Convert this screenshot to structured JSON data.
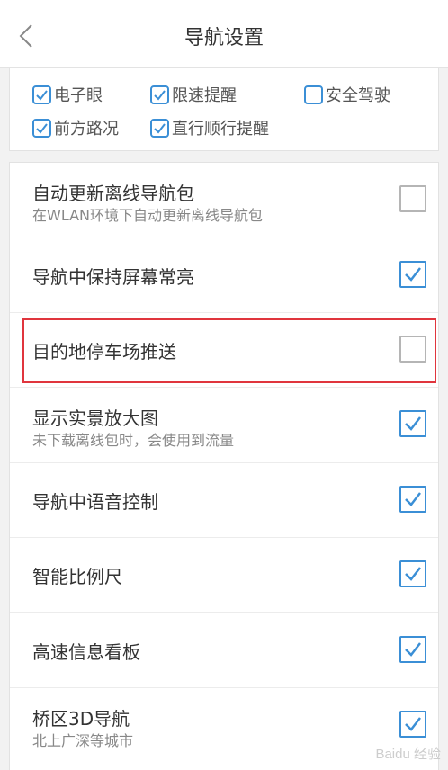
{
  "header": {
    "title": "导航设置",
    "back_icon": "chevron-left-icon"
  },
  "top_options": [
    {
      "label": "电子眼",
      "checked": true
    },
    {
      "label": "限速提醒",
      "checked": true
    },
    {
      "label": "安全驾驶",
      "checked": false
    },
    {
      "label": "前方路况",
      "checked": true
    },
    {
      "label": "直行顺行提醒",
      "checked": true
    }
  ],
  "settings": [
    {
      "title": "自动更新离线导航包",
      "subtitle": "在WLAN环境下自动更新离线导航包",
      "checked": false
    },
    {
      "title": "导航中保持屏幕常亮",
      "subtitle": "",
      "checked": true
    },
    {
      "title": "目的地停车场推送",
      "subtitle": "",
      "checked": false
    },
    {
      "title": "显示实景放大图",
      "subtitle": "未下载离线包时，会使用到流量",
      "checked": true
    },
    {
      "title": "导航中语音控制",
      "subtitle": "",
      "checked": true
    },
    {
      "title": "智能比例尺",
      "subtitle": "",
      "checked": true
    },
    {
      "title": "高速信息看板",
      "subtitle": "",
      "checked": true
    },
    {
      "title": "桥区3D导航",
      "subtitle": "北上广深等城市",
      "checked": true
    }
  ],
  "colors": {
    "accent": "#3b8fd6",
    "highlight": "#e0353d"
  },
  "watermark": "Baidu 经验"
}
